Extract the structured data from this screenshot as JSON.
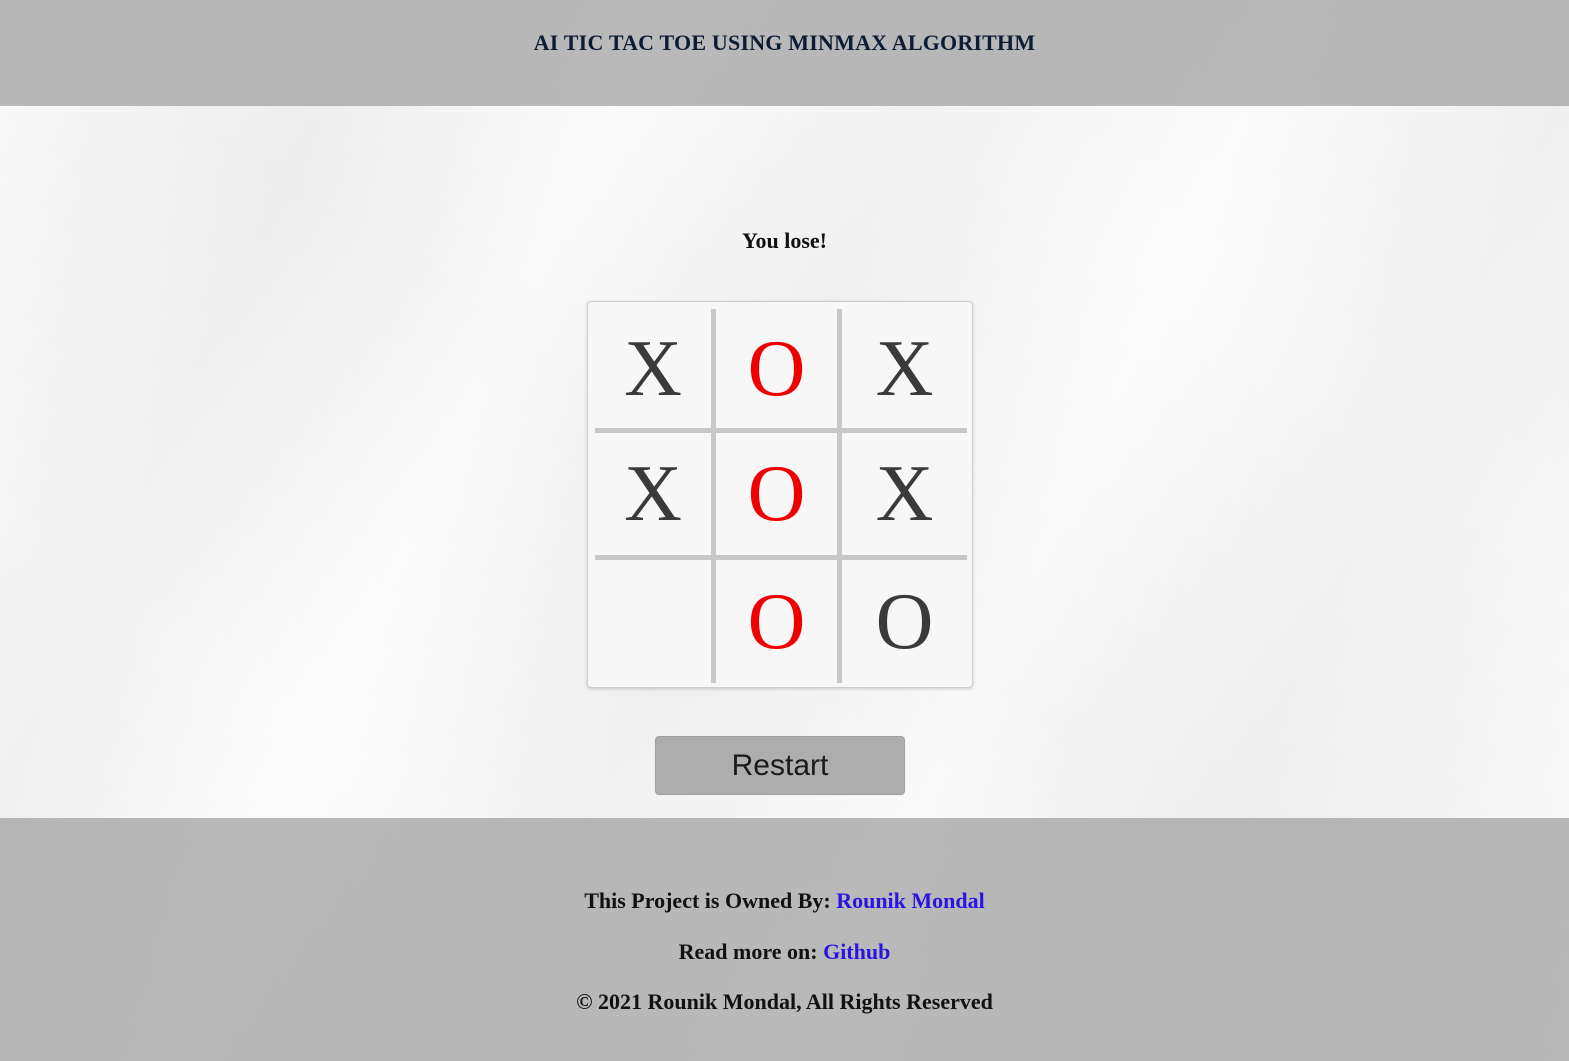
{
  "header": {
    "title": "AI TIC TAC TOE USING MINMAX ALGORITHM"
  },
  "game": {
    "status": "You lose!",
    "board": [
      [
        "X",
        "O",
        "X"
      ],
      [
        "X",
        "O",
        "X"
      ],
      [
        "",
        "O",
        "O"
      ]
    ],
    "winning_color": "#ee0000",
    "restart_label": "Restart"
  },
  "footer": {
    "owner_prefix": "This Project is Owned By: ",
    "owner_name": "Rounik Mondal",
    "readmore_prefix": "Read more on: ",
    "readmore_link": "Github",
    "copyright": "© 2021 Rounik Mondal, All Rights Reserved",
    "link_color": "#2a14e0"
  }
}
